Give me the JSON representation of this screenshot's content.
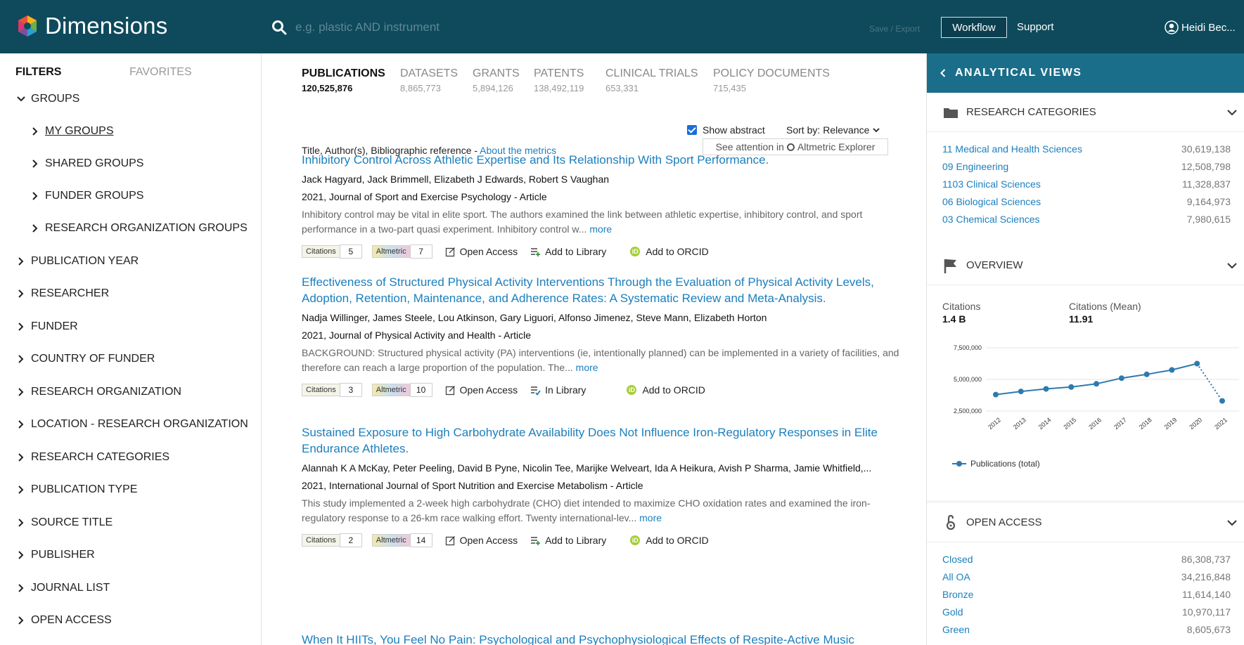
{
  "header": {
    "app_name": "Dimensions",
    "search_placeholder": "e.g. plastic AND instrument",
    "save_export": "Save / Export",
    "workflow": "Workflow",
    "support": "Support",
    "user": "Heidi Bec..."
  },
  "sidebar": {
    "tab_filters": "FILTERS",
    "tab_favorites": "FAVORITES",
    "groups": "GROUPS",
    "group_items": [
      "MY GROUPS",
      "SHARED GROUPS",
      "FUNDER GROUPS",
      "RESEARCH ORGANIZATION GROUPS"
    ],
    "filters": [
      "PUBLICATION YEAR",
      "RESEARCHER",
      "FUNDER",
      "COUNTRY OF FUNDER",
      "RESEARCH ORGANIZATION",
      "LOCATION - RESEARCH ORGANIZATION",
      "RESEARCH CATEGORIES",
      "PUBLICATION TYPE",
      "SOURCE TITLE",
      "PUBLISHER",
      "JOURNAL LIST",
      "OPEN ACCESS"
    ]
  },
  "content_tabs": [
    {
      "label": "PUBLICATIONS",
      "count": "120,525,876"
    },
    {
      "label": "DATASETS",
      "count": "8,865,773"
    },
    {
      "label": "GRANTS",
      "count": "5,894,126"
    },
    {
      "label": "PATENTS",
      "count": "138,492,119"
    },
    {
      "label": "CLINICAL TRIALS",
      "count": "653,331"
    },
    {
      "label": "POLICY DOCUMENTS",
      "count": "715,435"
    }
  ],
  "results": {
    "show_abstract": "Show abstract",
    "sort_label": "Sort by:",
    "sort_value": "Relevance",
    "columns_label": "Title, Author(s), Bibliographic reference - ",
    "about_metrics": "About the metrics",
    "see_attention": "See attention in",
    "altmetric_explorer": "Altmetric Explorer",
    "citations_label": "Citations",
    "altmetric_label": "Altmetric",
    "open_access": "Open Access",
    "more": "more",
    "add_to_orcid": "Add to ORCID",
    "items": [
      {
        "title": "Inhibitory Control Across Athletic Expertise and Its Relationship With Sport Performance.",
        "authors": "Jack Hagyard, Jack Brimmell, Elizabeth J Edwards, Robert S Vaughan",
        "meta": "2021, Journal of Sport and Exercise Psychology - Article",
        "abstract": "Inhibitory control may be vital in elite sport. The authors examined the link between athletic expertise, inhibitory control, and sport performance in a two-part quasi experiment. Inhibitory control w...",
        "citations": "5",
        "altmetric": "7",
        "library": "Add to Library"
      },
      {
        "title": "Effectiveness of Structured Physical Activity Interventions Through the Evaluation of Physical Activity Levels, Adoption, Retention, Maintenance, and Adherence Rates: A Systematic Review and Meta-Analysis.",
        "authors": "Nadja Willinger, James Steele, Lou Atkinson, Gary Liguori, Alfonso Jimenez, Steve Mann, Elizabeth Horton",
        "meta": "2021, Journal of Physical Activity and Health - Article",
        "abstract": "BACKGROUND: Structured physical activity (PA) interventions (ie, intentionally planned) can be implemented in a variety of facilities, and therefore can reach a large proportion of the population. The...",
        "citations": "3",
        "altmetric": "10",
        "library": "In Library"
      },
      {
        "title": "Sustained Exposure to High Carbohydrate Availability Does Not Influence Iron-Regulatory Responses in Elite Endurance Athletes.",
        "authors": "Alannah K A McKay, Peter Peeling, David B Pyne, Nicolin Tee, Marijke Welveart, Ida A Heikura, Avish P Sharma, Jamie Whitfield,...",
        "meta": "2021, International Journal of Sport Nutrition and Exercise Metabolism - Article",
        "abstract": "This study implemented a 2-week high carbohydrate (CHO) diet intended to maximize CHO oxidation rates and examined the iron-regulatory response to a 26-km race walking effort. Twenty international-lev...",
        "citations": "2",
        "altmetric": "14",
        "library": "Add to Library"
      },
      {
        "title": "When It HIITs, You Feel No Pain: Psychological and Psychophysiological Effects of Respite-Active Music"
      }
    ]
  },
  "analytical": {
    "title": "ANALYTICAL VIEWS",
    "research_categories": {
      "title": "RESEARCH CATEGORIES",
      "items": [
        {
          "name": "11 Medical and Health Sciences",
          "value": "30,619,138"
        },
        {
          "name": "09 Engineering",
          "value": "12,508,798"
        },
        {
          "name": "1103 Clinical Sciences",
          "value": "11,328,837"
        },
        {
          "name": "06 Biological Sciences",
          "value": "9,164,973"
        },
        {
          "name": "03 Chemical Sciences",
          "value": "7,980,615"
        }
      ]
    },
    "overview": {
      "title": "OVERVIEW",
      "citations_label": "Citations",
      "citations_value": "1.4 B",
      "mean_label": "Citations (Mean)",
      "mean_value": "11.91"
    },
    "open_access": {
      "title": "OPEN ACCESS",
      "items": [
        {
          "name": "Closed",
          "value": "86,308,737"
        },
        {
          "name": "All OA",
          "value": "34,216,848"
        },
        {
          "name": "Bronze",
          "value": "11,614,140"
        },
        {
          "name": "Gold",
          "value": "10,970,117"
        },
        {
          "name": "Green",
          "value": "8,605,673"
        }
      ]
    }
  },
  "chart_data": {
    "type": "line",
    "x": [
      "2012",
      "2013",
      "2014",
      "2015",
      "2016",
      "2017",
      "2018",
      "2019",
      "2020",
      "2021"
    ],
    "y_ticks": [
      "7,500,000",
      "5,000,000",
      "2,500,000"
    ],
    "ylim": [
      2500000,
      7500000
    ],
    "series": [
      {
        "name": "Publications (total)",
        "values": [
          3800000,
          4050000,
          4250000,
          4400000,
          4650000,
          5100000,
          5400000,
          5750000,
          6250000,
          3300000
        ]
      }
    ],
    "color": "#2e7ab0"
  }
}
